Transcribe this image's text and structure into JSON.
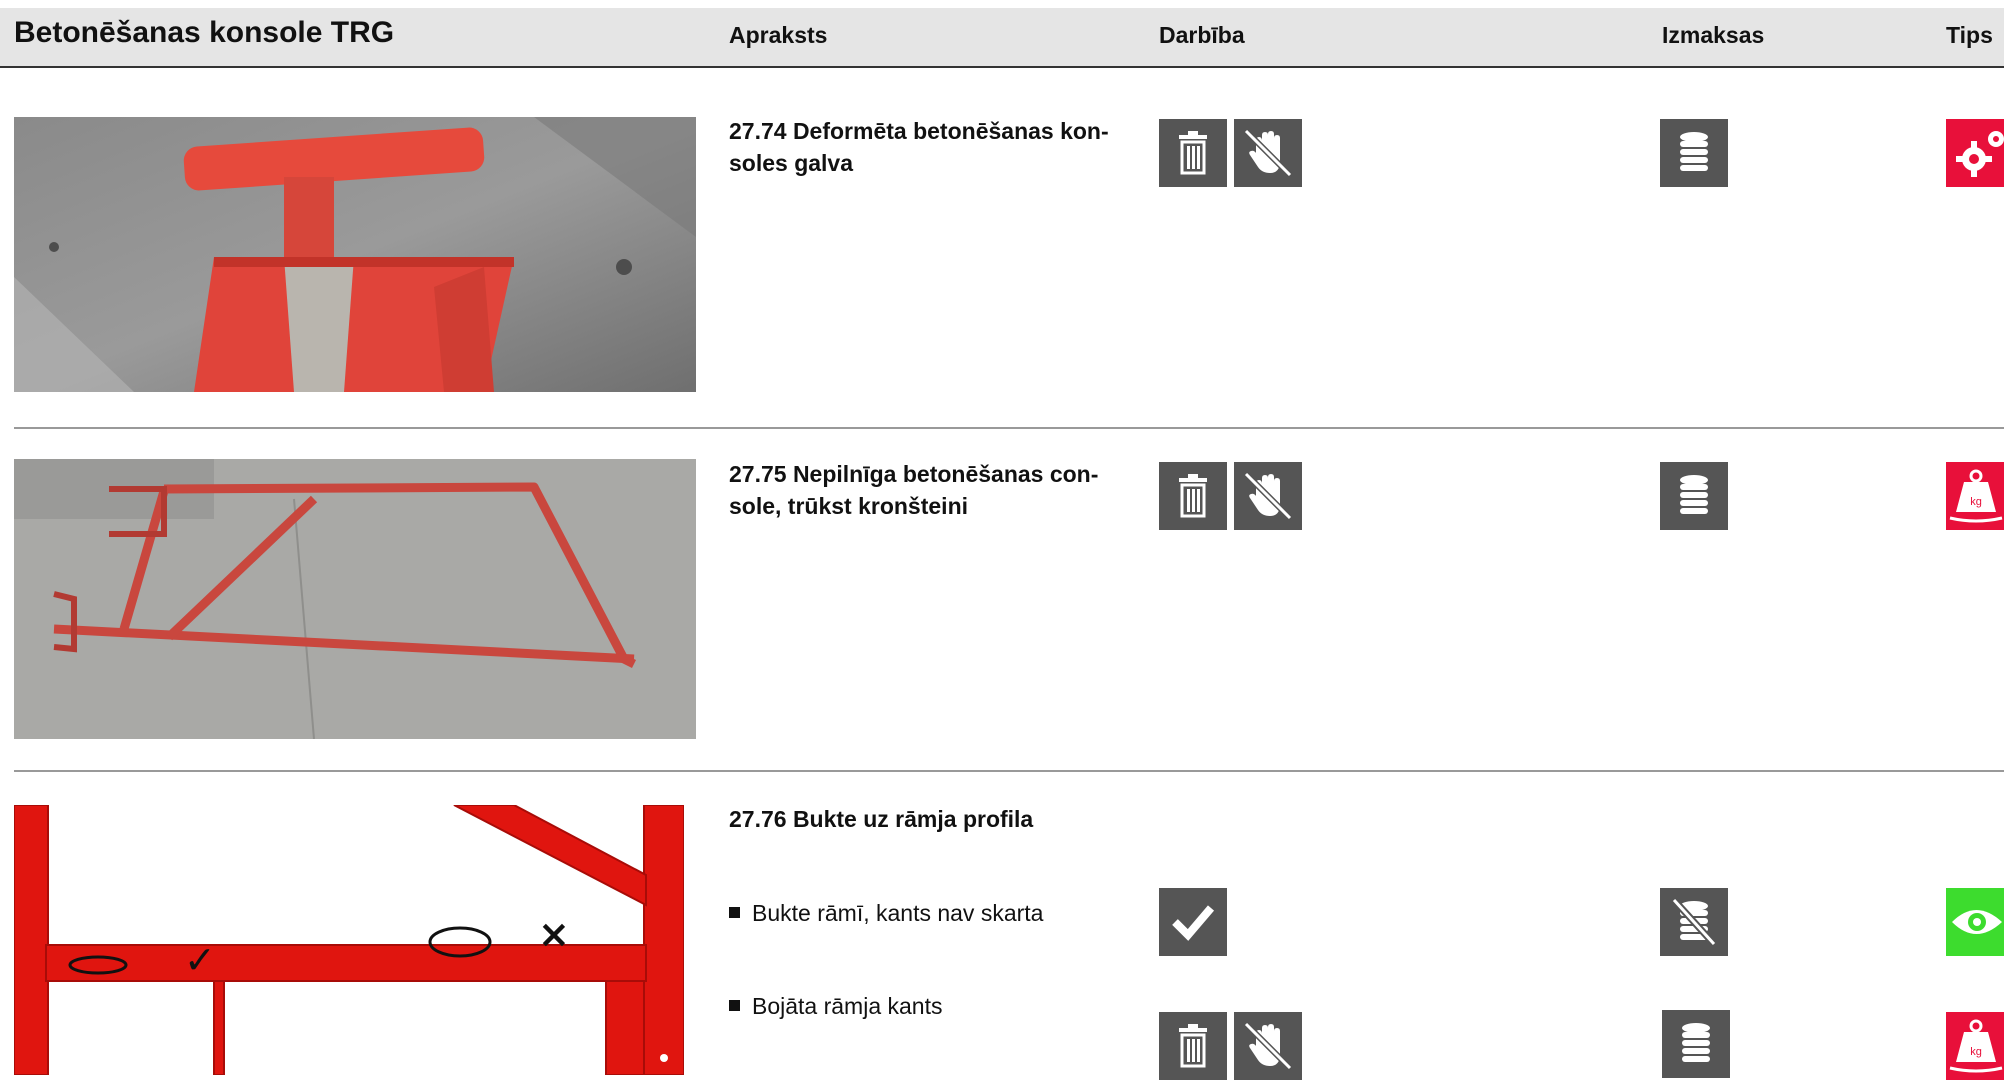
{
  "header": {
    "title": "Betonēšanas konsole TRG",
    "col_description": "Apraksts",
    "col_action": "Darbība",
    "col_cost": "Izmaksas",
    "col_tip": "Tips"
  },
  "rows": [
    {
      "description_line1": "27.74 Deformēta betonēšanas kon-",
      "description_line2": "soles galva",
      "actions": [
        "trash-icon",
        "no-hand-icon"
      ],
      "cost": "coins-icon",
      "tip": "gears-icon",
      "tip_color": "#e8103a"
    },
    {
      "description_line1": "27.75 Nepilnīga betonēšanas con-",
      "description_line2": "sole, trūkst kronšteini",
      "actions": [
        "trash-icon",
        "no-hand-icon"
      ],
      "cost": "coins-icon",
      "tip": "weight-icon",
      "tip_color": "#e8103a"
    },
    {
      "description": "27.76 Bukte uz rāmja profila",
      "items": [
        {
          "label": "Bukte rāmī, kants nav skarta",
          "actions": [
            "check-icon"
          ],
          "cost": "no-coins-icon",
          "tip": "eye-icon",
          "tip_color": "#3ddc2e"
        },
        {
          "label": "Bojāta rāmja kants",
          "actions": [
            "trash-icon",
            "no-hand-icon"
          ],
          "cost": "coins-icon",
          "tip": "weight-icon",
          "tip_color": "#e8103a"
        }
      ]
    }
  ],
  "diagram": {
    "good_mark": "✓",
    "bad_mark": "×"
  },
  "colors": {
    "icon_bg": "#555555",
    "accent_red": "#e8103a",
    "accent_green": "#3ddc2e",
    "frame_red": "#e0150f"
  }
}
